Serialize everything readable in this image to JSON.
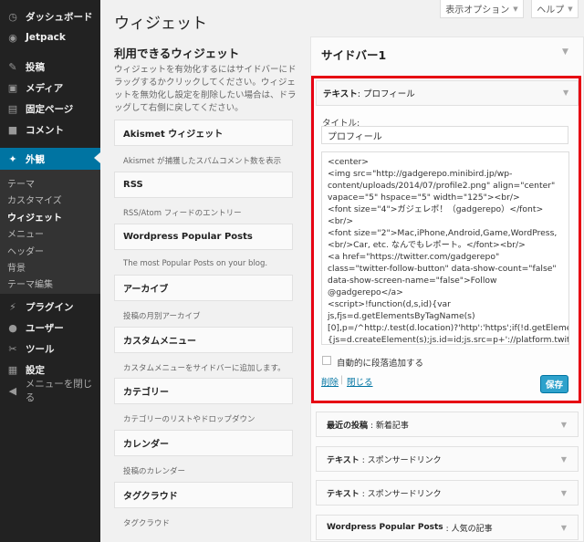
{
  "sidebar": {
    "items": [
      {
        "label": "ダッシュボード",
        "icon": "dashboard-icon",
        "glyph": "◷"
      },
      {
        "label": "Jetpack",
        "icon": "jetpack-icon",
        "glyph": "◉"
      },
      {
        "label": "投稿",
        "icon": "pushpin-icon",
        "glyph": "✎"
      },
      {
        "label": "メディア",
        "icon": "media-icon",
        "glyph": "▣"
      },
      {
        "label": "固定ページ",
        "icon": "page-icon",
        "glyph": "▤"
      },
      {
        "label": "コメント",
        "icon": "comment-icon",
        "glyph": "■"
      },
      {
        "label": "外観",
        "icon": "appearance-icon",
        "glyph": "✦"
      },
      {
        "label": "プラグイン",
        "icon": "plugin-icon",
        "glyph": "⚡"
      },
      {
        "label": "ユーザー",
        "icon": "user-icon",
        "glyph": "●"
      },
      {
        "label": "ツール",
        "icon": "tools-icon",
        "glyph": "✂"
      },
      {
        "label": "設定",
        "icon": "settings-icon",
        "glyph": "▦"
      },
      {
        "label": "メニューを閉じる",
        "icon": "collapse-icon",
        "glyph": "◀"
      }
    ],
    "submenu": [
      "テーマ",
      "カスタマイズ",
      "ウィジェット",
      "メニュー",
      "ヘッダー",
      "背景",
      "テーマ編集"
    ]
  },
  "header": {
    "title": "ウィジェット",
    "screen_options": "表示オプション",
    "help": "ヘルプ",
    "arrow": "▼"
  },
  "available": {
    "title": "利用できるウィジェット",
    "description": "ウィジェットを有効化するにはサイドバーにドラッグするかクリックしてください。ウィジェットを無効化し設定を削除したい場合は、ドラッグして右側に戻してください。",
    "widgets": [
      {
        "name": "Akismet ウィジェット",
        "desc": "Akismet が捕獲したスパムコメント数を表示"
      },
      {
        "name": "RSS",
        "desc": "RSS/Atom フィードのエントリー"
      },
      {
        "name": "Wordpress Popular Posts",
        "desc": "The most Popular Posts on your blog."
      },
      {
        "name": "アーカイブ",
        "desc": "投稿の月別アーカイブ"
      },
      {
        "name": "カスタムメニュー",
        "desc": "カスタムメニューをサイドバーに追加します。"
      },
      {
        "name": "カテゴリー",
        "desc": "カテゴリーのリストやドロップダウン"
      },
      {
        "name": "カレンダー",
        "desc": "投稿のカレンダー"
      },
      {
        "name": "タグクラウド",
        "desc": "タグクラウド"
      }
    ]
  },
  "sidebar_area": {
    "title": "サイドバー1",
    "open_widget": {
      "header_bold": "テキスト",
      "header_rest": ": プロフィール",
      "title_label": "タイトル:",
      "title_value": "プロフィール",
      "content": "<center>\n<img src=\"http://gadgerepo.minibird.jp/wp-content/uploads/2014/07/profile2.png\" align=\"center\" vapace=\"5\" hspace=\"5\" width=\"125\"><br/>\n<font size=\"4\">ガジェレポ！（gadgerepo）</font><br/>\n<font size=\"2\">Mac,iPhone,Android,Game,WordPress,<br/>Car, etc. なんでもレポート。</font><br/>\n<a href=\"https://twitter.com/gadgerepo\" class=\"twitter-follow-button\" data-show-count=\"false\" data-show-screen-name=\"false\">Follow @gadgerepo</a>\n<script>!function(d,s,id){var js,fjs=d.getElementsByTagName(s)[0],p=/^http:/.test(d.location)?'http':'https';if(!d.getElementById(id)){js=d.createElement(s);js.id=id;js.src=p+'://platform.twitter.com/widgets.js';fjs.parentNode.insertBefore(js,fjs);}}",
      "autop_label": "自動的に段落追加する",
      "delete": "削除",
      "separator": "|",
      "close": "閉じる",
      "save": "保存"
    },
    "collapsed": [
      {
        "bold": "最近の投稿",
        "rest": ": 新着記事"
      },
      {
        "bold": "テキスト",
        "rest": ": スポンサードリンク"
      },
      {
        "bold": "テキスト",
        "rest": ": スポンサードリンク"
      },
      {
        "bold": "Wordpress Popular Posts",
        "rest": ": 人気の記事"
      }
    ],
    "arrow": "▼"
  }
}
